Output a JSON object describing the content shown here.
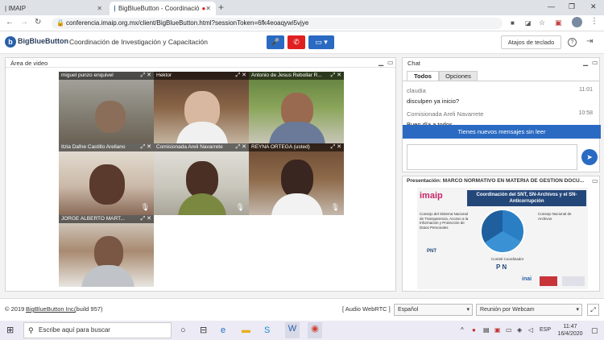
{
  "browser": {
    "tab1_title": "| IMAIP",
    "tab2_title": "BigBlueButton - Coordinació",
    "url": "conferencia.imaip.org.mx/client/BigBlueButton.html?sessionToken=6fk4eoaqywi5vjye",
    "icons": [
      "back-arrow-icon",
      "forward-arrow-icon",
      "reload-icon",
      "lock-icon",
      "camera-icon",
      "translate-icon",
      "star-icon",
      "extension-icon",
      "profile-icon",
      "menu-icon"
    ]
  },
  "app": {
    "brand": "BigBlueButton",
    "meeting_title": "Coordinación de Investigación y Capacitación",
    "shortcuts_label": "Atajos de teclado",
    "accent": "#2a6ac2"
  },
  "video": {
    "panel_title": "Área de video",
    "tiles": [
      {
        "name": "miguel punzo enquivel"
      },
      {
        "name": "Hektor"
      },
      {
        "name": "Antonio de Jesus Rebollar R..."
      },
      {
        "name": "Itzia Dafne Castillo Arellano"
      },
      {
        "name": "Comisionada Areli Navarrete"
      },
      {
        "name": "REYNA ORTEGA (usted)"
      },
      {
        "name": "JORGE ALBERTO MART..."
      }
    ]
  },
  "chat": {
    "panel_title": "Chat",
    "tabs": [
      "Todos",
      "Opciones"
    ],
    "messages": [
      {
        "author": "claudia",
        "time": "11:01",
        "text": "disculpen ya inicio?"
      },
      {
        "author": "Comisionada Areli Navarrete",
        "time": "10:58",
        "text": "Buen día a todos"
      }
    ],
    "new_messages_banner": "Tienes nuevos mensajes sin leer"
  },
  "presentation": {
    "title": "Presentación: MARCO NORMATIVO EN MATERIA DE GESTION DOCU...",
    "slide_logo": "imaip",
    "slide_heading": "Coordinación del SNT, SN-Archivos y el SN-Anticorrupción",
    "slide_left_text": "Consejo del Sistema Nacional de Transparencia, Acceso a la Información y Protección de Datos Personales",
    "slide_right_text": "Consejo Nacional de Archivos",
    "slide_bottom_text": "Comité Coordinador",
    "slide_pnt": "PNT",
    "slide_pn": "P N",
    "slide_inai": "inai"
  },
  "footer": {
    "copyright": "© 2019",
    "copyright_link": "BigBlueButton Inc.",
    "build": "(build 957)",
    "audio": "[ Audio WebRTC ]",
    "language": "Español",
    "layout": "Reunión por Webcam"
  },
  "taskbar": {
    "search_placeholder": "Escribe aquí para buscar",
    "lang": "ESP",
    "time": "11:47",
    "date": "16/4/2020"
  }
}
